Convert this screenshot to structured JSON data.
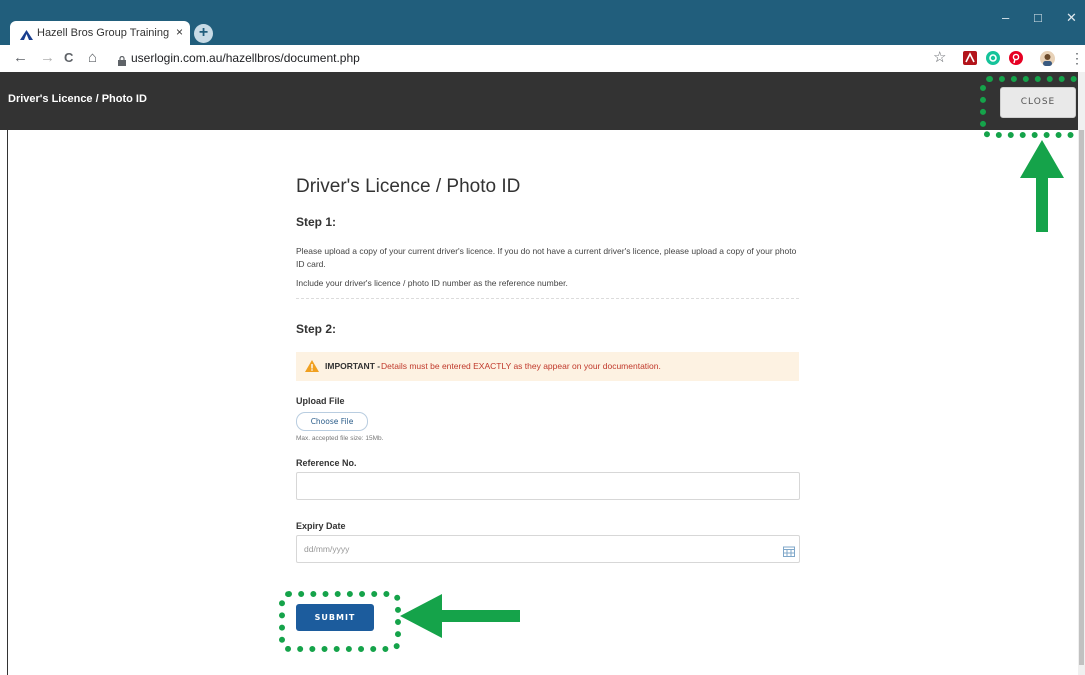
{
  "browser": {
    "tab_title": "Hazell Bros Group Training Platfo",
    "tab_close": "×",
    "new_tab": "+",
    "url": "userlogin.com.au/hazellbros/document.php",
    "win_minimize": "–",
    "win_maximize": "□",
    "win_close": "✕",
    "back": "←",
    "forward": "→",
    "reload": "C",
    "home": "⌂",
    "bookmark_star": "☆",
    "menu": "⋮"
  },
  "header": {
    "title": "Driver's Licence / Photo ID",
    "close_label": "CLOSE"
  },
  "main": {
    "heading": "Driver's Licence / Photo ID",
    "step1_title": "Step 1:",
    "step1_text": "Please upload a copy of your current driver's licence. If you do not have a current driver's licence, please upload a copy of your photo ID card.",
    "step1_text2": "Include your driver's licence / photo ID number as the reference number.",
    "step2_title": "Step 2:",
    "alert_strong": "IMPORTANT -",
    "alert_text": "Details must be entered EXACTLY as they appear on your documentation.",
    "upload_label": "Upload File",
    "choose_file": "Choose File",
    "file_hint": "Max. accepted file size: 15Mb.",
    "reference_label": "Reference No.",
    "reference_value": "",
    "expiry_label": "Expiry Date",
    "expiry_placeholder": "dd/mm/yyyy",
    "submit_label": "SUBMIT"
  },
  "colors": {
    "tabstrip": "#215e7c",
    "header": "#333333",
    "submit": "#1c5c9d",
    "alert_bg": "#fdf2e2",
    "alert_text": "#c0392b",
    "annotation": "#15a34a"
  },
  "icons": [
    "app-favicon-icon",
    "lock-icon",
    "pdf-extension-icon",
    "grammarly-icon",
    "pinterest-icon",
    "profile-avatar-icon",
    "warning-icon",
    "calendar-icon"
  ]
}
